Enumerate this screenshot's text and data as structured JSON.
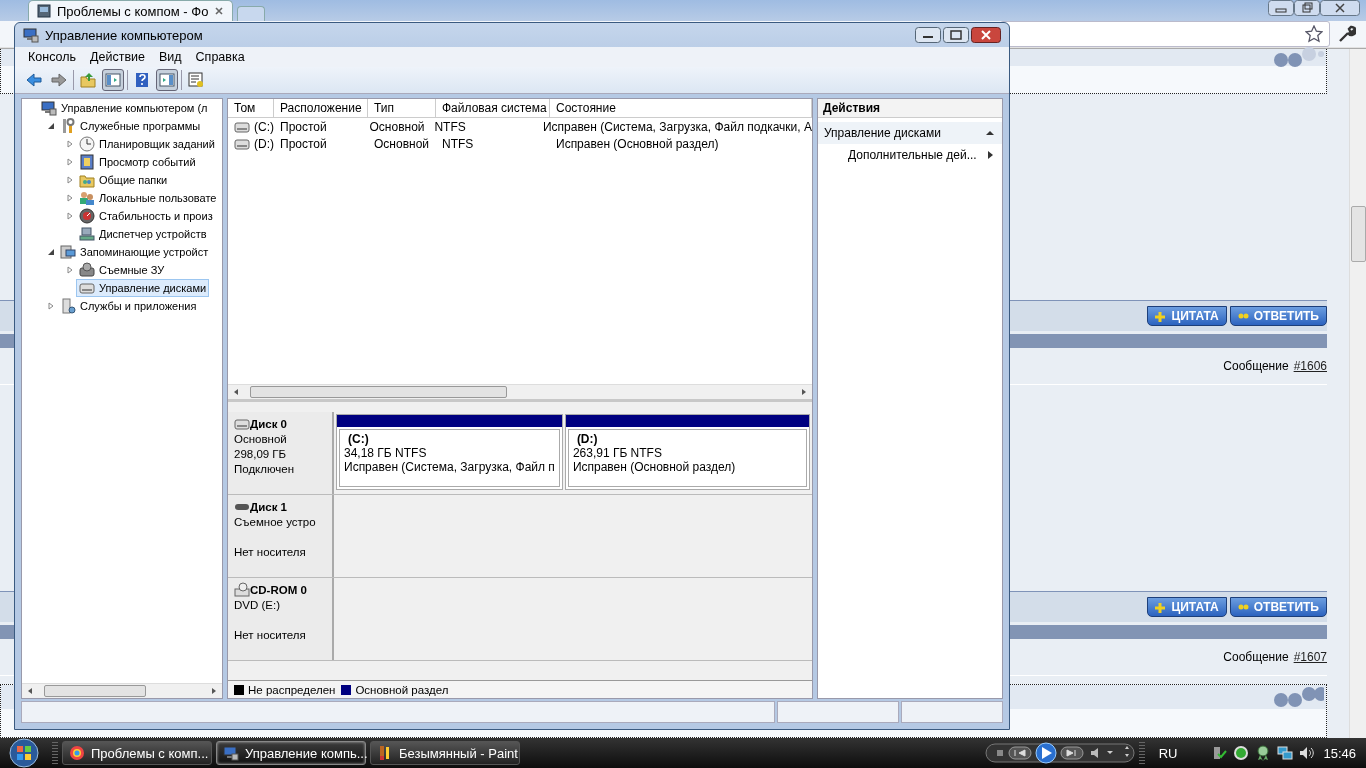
{
  "browser": {
    "tab_title": "Проблемы с компом - Фо",
    "posts": [
      {
        "buttons": [
          {
            "kind": "quote",
            "label": "ЦИТАТА"
          },
          {
            "kind": "reply",
            "label": "ОТВЕТИТЬ"
          }
        ],
        "message_label": "Сообщение",
        "message_number": "#1606"
      },
      {
        "buttons": [
          {
            "kind": "quote",
            "label": "ЦИТАТА"
          },
          {
            "kind": "reply",
            "label": "ОТВЕТИТЬ"
          }
        ],
        "message_label": "Сообщение",
        "message_number": "#1607"
      }
    ]
  },
  "window": {
    "title": "Управление компьютером",
    "menu": [
      "Консоль",
      "Действие",
      "Вид",
      "Справка"
    ],
    "toolbar": [
      {
        "buttons": [
          {
            "kind": "back",
            "pressed": false
          },
          {
            "kind": "forward",
            "pressed": false
          }
        ]
      },
      {
        "buttons": [
          {
            "kind": "up",
            "pressed": false
          },
          {
            "kind": "tree",
            "pressed": true
          }
        ]
      },
      {
        "buttons": [
          {
            "kind": "help",
            "pressed": false
          },
          {
            "kind": "pane",
            "pressed": true
          }
        ]
      },
      {
        "buttons": [
          {
            "kind": "properties",
            "pressed": false
          }
        ]
      }
    ],
    "tree": [
      {
        "label": "Управление компьютером (л",
        "kind": "computer",
        "expander": false,
        "selected": false,
        "children": [
          {
            "label": "Служебные программы",
            "kind": "tools",
            "expander": true,
            "selected": false,
            "children": [
              {
                "label": "Планировщик заданий",
                "kind": "clock",
                "expander": true,
                "selected": false
              },
              {
                "label": "Просмотр событий",
                "kind": "log",
                "expander": true,
                "selected": false
              },
              {
                "label": "Общие папки",
                "kind": "folder",
                "expander": true,
                "selected": false
              },
              {
                "label": "Локальные пользовате",
                "kind": "users",
                "expander": true,
                "selected": false
              },
              {
                "label": "Стабильность и произ",
                "kind": "gauge",
                "expander": true,
                "selected": false
              },
              {
                "label": "Диспетчер устройств",
                "kind": "devices",
                "expander": false,
                "selected": false
              }
            ]
          },
          {
            "label": "Запоминающие устройст",
            "kind": "storage",
            "expander": true,
            "selected": false,
            "children": [
              {
                "label": "Съемные ЗУ",
                "kind": "drive",
                "expander": true,
                "selected": false
              },
              {
                "label": "Управление дисками",
                "kind": "disk",
                "expander": false,
                "selected": true
              }
            ]
          },
          {
            "label": "Службы и приложения",
            "kind": "services",
            "expander": true,
            "selected": false
          }
        ]
      }
    ],
    "volumes": {
      "columns": [
        "Том",
        "Расположение",
        "Тип",
        "Файловая система",
        "Состояние"
      ],
      "rows": [
        {
          "cells": [
            "(C:)",
            "Простой",
            "Основной",
            "NTFS",
            "Исправен (Система, Загрузка, Файл подкачки, А"
          ]
        },
        {
          "cells": [
            "(D:)",
            "Простой",
            "Основной",
            "NTFS",
            "Исправен (Основной раздел)"
          ]
        }
      ]
    },
    "disks": [
      {
        "kind": "hdd",
        "name": "Диск 0",
        "type": "Основной",
        "size": "298,09 ГБ",
        "status": "Подключен",
        "partitions": [
          {
            "label": "(C:)",
            "size": "34,18 ГБ NTFS",
            "status": "Исправен (Система, Загрузка, Файл п"
          },
          {
            "label": "(D:)",
            "size": "263,91 ГБ NTFS",
            "status": "Исправен (Основной раздел)"
          }
        ]
      },
      {
        "kind": "removable",
        "name": "Диск 1",
        "type": "Съемное устро",
        "status": "Нет носителя"
      },
      {
        "kind": "cdrom",
        "name": "CD-ROM 0",
        "type": "DVD (E:)",
        "status": "Нет носителя"
      }
    ],
    "legend": [
      {
        "label": "Не распределен",
        "color": "#000000"
      },
      {
        "label": "Основной раздел",
        "color": "#000080"
      }
    ],
    "actions": {
      "title": "Действия",
      "section": "Управление дисками",
      "items": [
        "Дополнительные дей..."
      ]
    }
  },
  "taskbar": {
    "tasks": [
      {
        "kind": "browser",
        "label": "Проблемы с комп...",
        "selected": false
      },
      {
        "kind": "mmc",
        "label": "Управление компь...",
        "selected": true
      },
      {
        "kind": "paint",
        "label": "Безымянный - Paint",
        "selected": false
      }
    ],
    "language": "RU",
    "clock": "15:46"
  }
}
